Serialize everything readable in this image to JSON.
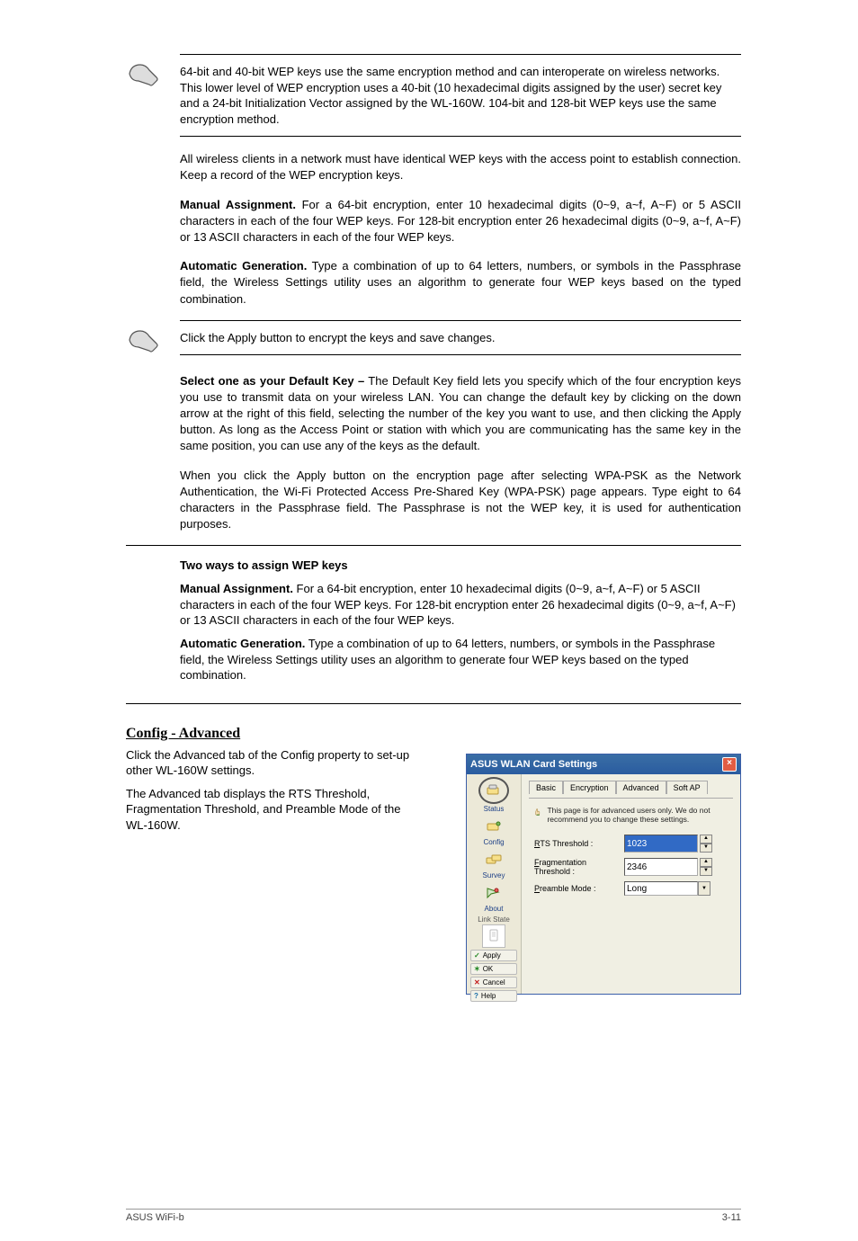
{
  "note1": {
    "text": "64-bit and 40-bit WEP keys use the same encryption method and can interoperate on wireless networks. This lower level of WEP encryption uses a 40-bit (10 hexadecimal digits assigned by the user) secret key and a 24-bit Initialization Vector assigned by the WL-160W. 104-bit and 128-bit WEP keys use the same encryption method."
  },
  "para1": "All wireless clients in a network must have identical WEP keys with the access point to establish connection. Keep a record of the WEP encryption keys.",
  "para_manual_bold": "Manual Assignment.",
  "para_manual": " For a 64-bit encryption, enter 10 hexadecimal digits (0~9, a~f, A~F) or 5 ASCII characters in each of the four WEP keys. For 128-bit encryption enter 26 hexadecimal digits (0~9, a~f, A~F) or 13 ASCII characters in each of the four WEP keys.",
  "para_auto_bold": "Automatic Generation.",
  "para_auto": " Type a combination of up to 64 letters, numbers, or symbols in the Passphrase field, the Wireless Settings utility uses an algorithm to generate four WEP keys based on the typed combination.",
  "para_select_bold": "Select one as your Default Key –",
  "para_select": " The Default Key field lets you specify which of the four encryption keys you use to transmit data on your wireless LAN. You can change the default key by clicking on the down arrow at the right of this field, selecting the number of the key you want to use, and then clicking the Apply button. As long as the Access Point or station with which you are communicating has the same key in the same position, you can use any of the keys as the default.",
  "para_wpa": "When you click the Apply button on the encryption page after selecting WPA-PSK as the Network Authentication, the Wi-Fi Protected Access Pre-Shared Key (WPA-PSK) page appears. Type eight to 64 characters in the Passphrase field. The Passphrase is not the WEP key, it is used for authentication purposes.",
  "note2": {
    "text": "Click the Apply button to encrypt the keys and save changes."
  },
  "two_ways": {
    "lead": "Two ways to assign WEP keys",
    "way1_bold": "Manual Assignment.",
    "way1": " For a 64-bit encryption, enter 10 hexadecimal digits (0~9, a~f, A~F) or 5 ASCII characters in each of the four WEP keys. For 128-bit encryption enter 26 hexadecimal digits (0~9, a~f, A~F) or 13 ASCII characters in each of the four WEP keys.",
    "way2_bold": "Automatic Generation.",
    "way2": " Type a combination of up to 64 letters, numbers, or symbols in the Passphrase field, the Wireless Settings utility uses an algorithm to generate four WEP keys based on the typed combination."
  },
  "section_head": "Config - Advanced",
  "section_paras": [
    "Click the Advanced tab of the Config property to set-up other WL-160W settings.",
    "The Advanced tab displays the RTS Threshold, Fragmentation Threshold, and Preamble Mode of the WL-160W."
  ],
  "dlg": {
    "title": "ASUS WLAN Card Settings",
    "close": "×",
    "sidebar": {
      "items": [
        {
          "label": "Status",
          "icon": "card-icon",
          "circled": true
        },
        {
          "label": "Config",
          "icon": "card-icon"
        },
        {
          "label": "Survey",
          "icon": "cards-icon"
        },
        {
          "label": "About",
          "icon": "send-icon"
        }
      ],
      "link_state_label": "Link State",
      "buttons": {
        "apply": "Apply",
        "ok": "OK",
        "cancel": "Cancel",
        "help": "Help"
      }
    },
    "tabs": [
      "Basic",
      "Encryption",
      "Advanced",
      "Soft AP"
    ],
    "active_tab": "Advanced",
    "info_text": "This page is for advanced users only. We do not recommend you to change these settings.",
    "fields": {
      "rts_label": "RTS Threshold :",
      "rts_value": "1023",
      "frag_label": "Fragmentation Threshold :",
      "frag_value": "2346",
      "preamble_label": "Preamble Mode :",
      "preamble_value": "Long"
    }
  },
  "footer": {
    "left": "ASUS WiFi-b",
    "right": "3-11"
  }
}
